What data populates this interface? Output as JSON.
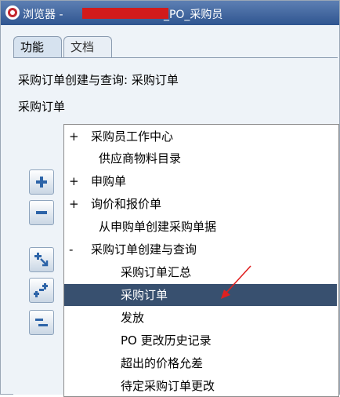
{
  "window": {
    "title_prefix": "浏览器 - ",
    "title_suffix": "_PO_采购员",
    "logo_icon": "oracle-logo-icon"
  },
  "tabs": [
    {
      "label": "功能",
      "active": true
    },
    {
      "label": "文档",
      "active": false
    }
  ],
  "heading": "采购订单创建与查询: 采购订单",
  "subheading": "采购订单",
  "tree": {
    "items": [
      {
        "mark": "+",
        "label": "采购员工作中心",
        "level": 0
      },
      {
        "mark": "",
        "label": "供应商物料目录",
        "level": 1
      },
      {
        "mark": "+",
        "label": "申购单",
        "level": 0
      },
      {
        "mark": "+",
        "label": "询价和报价单",
        "level": 0
      },
      {
        "mark": "",
        "label": "从申购单创建采购单据",
        "level": 1
      },
      {
        "mark": "-",
        "label": "采购订单创建与查询",
        "level": 0
      },
      {
        "mark": "",
        "label": "采购订单汇总",
        "level": 2
      },
      {
        "mark": "",
        "label": "采购订单",
        "level": 2,
        "selected": true
      },
      {
        "mark": "",
        "label": "发放",
        "level": 2
      },
      {
        "mark": "",
        "label": "PO 更改历史记录",
        "level": 2
      },
      {
        "mark": "",
        "label": "超出的价格允差",
        "level": 2
      },
      {
        "mark": "",
        "label": "待定采购订单更改",
        "level": 2
      }
    ]
  },
  "side_buttons": [
    {
      "name": "expand-button",
      "icon": "plus-icon"
    },
    {
      "name": "collapse-button",
      "icon": "minus-icon"
    },
    {
      "name": "expand-all-button",
      "icon": "expand-all-icon"
    },
    {
      "name": "expand-branch-button",
      "icon": "expand-branch-icon"
    },
    {
      "name": "collapse-all-button",
      "icon": "collapse-all-icon"
    }
  ],
  "colors": {
    "titlebar": "#2f5590",
    "selected_row": "#38506f",
    "annotation_arrow": "#e02020",
    "redaction": "#d21b1b"
  }
}
